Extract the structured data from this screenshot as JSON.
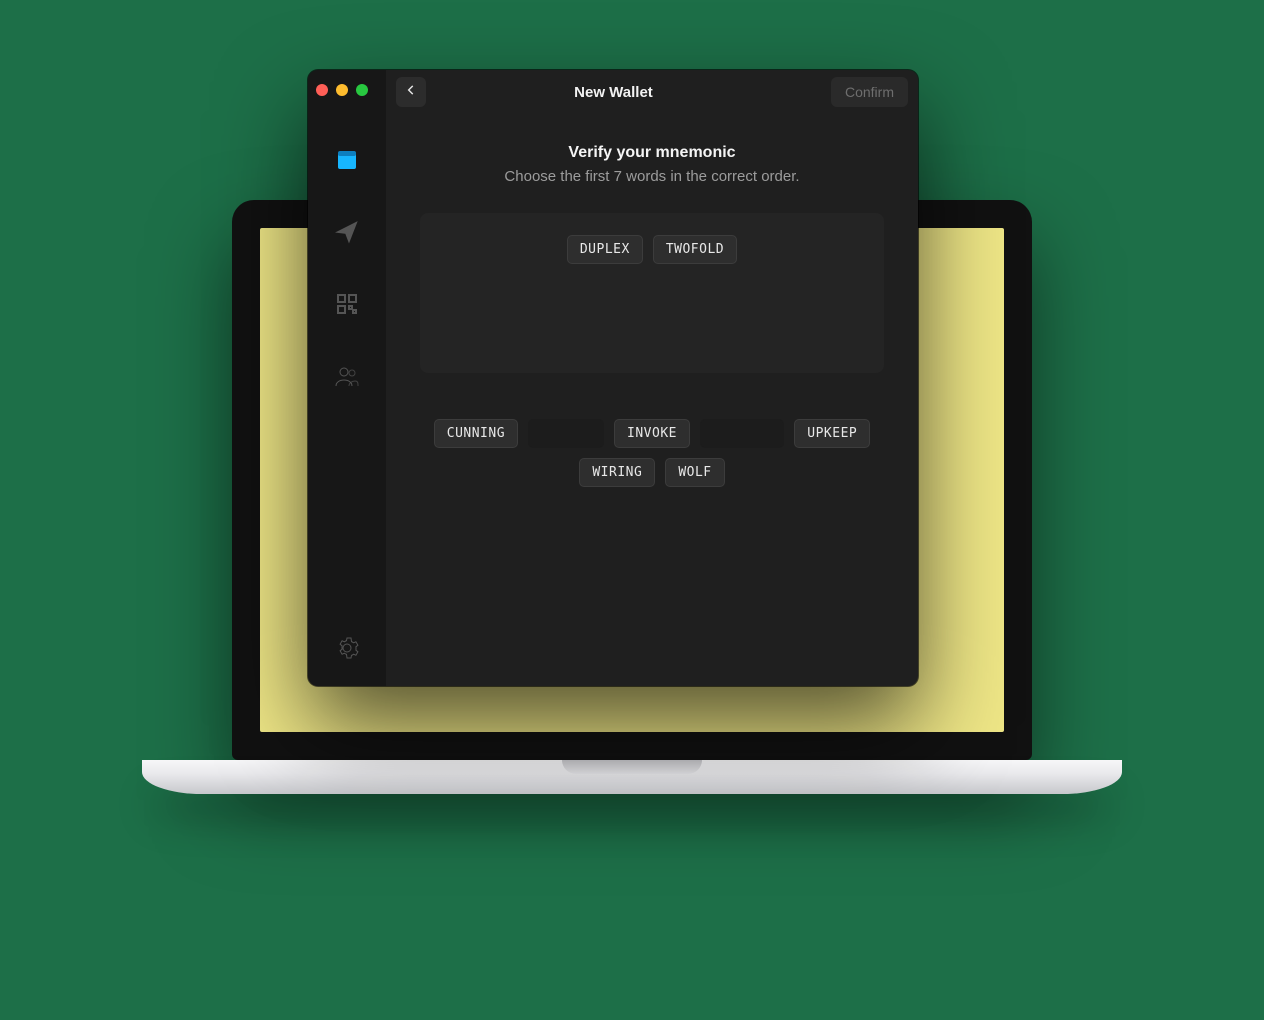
{
  "window": {
    "title": "New Wallet",
    "confirm_label": "Confirm"
  },
  "sidebar": {
    "items": [
      {
        "icon": "wallet-icon",
        "active": true
      },
      {
        "icon": "send-icon",
        "active": false
      },
      {
        "icon": "qr-icon",
        "active": false
      },
      {
        "icon": "contacts-icon",
        "active": false
      }
    ],
    "settings_icon": "gear-icon"
  },
  "verify": {
    "heading": "Verify your mnemonic",
    "subheading": "Choose the first 7 words in the correct order.",
    "selected": [
      "DUPLEX",
      "TWOFOLD"
    ],
    "pool": [
      {
        "word": "CUNNING",
        "used": false
      },
      {
        "word": "DUPLEX",
        "used": true
      },
      {
        "word": "INVOKE",
        "used": false
      },
      {
        "word": "TWOFOLD",
        "used": true
      },
      {
        "word": "UPKEEP",
        "used": false
      },
      {
        "word": "WIRING",
        "used": false
      },
      {
        "word": "WOLF",
        "used": false
      }
    ]
  }
}
